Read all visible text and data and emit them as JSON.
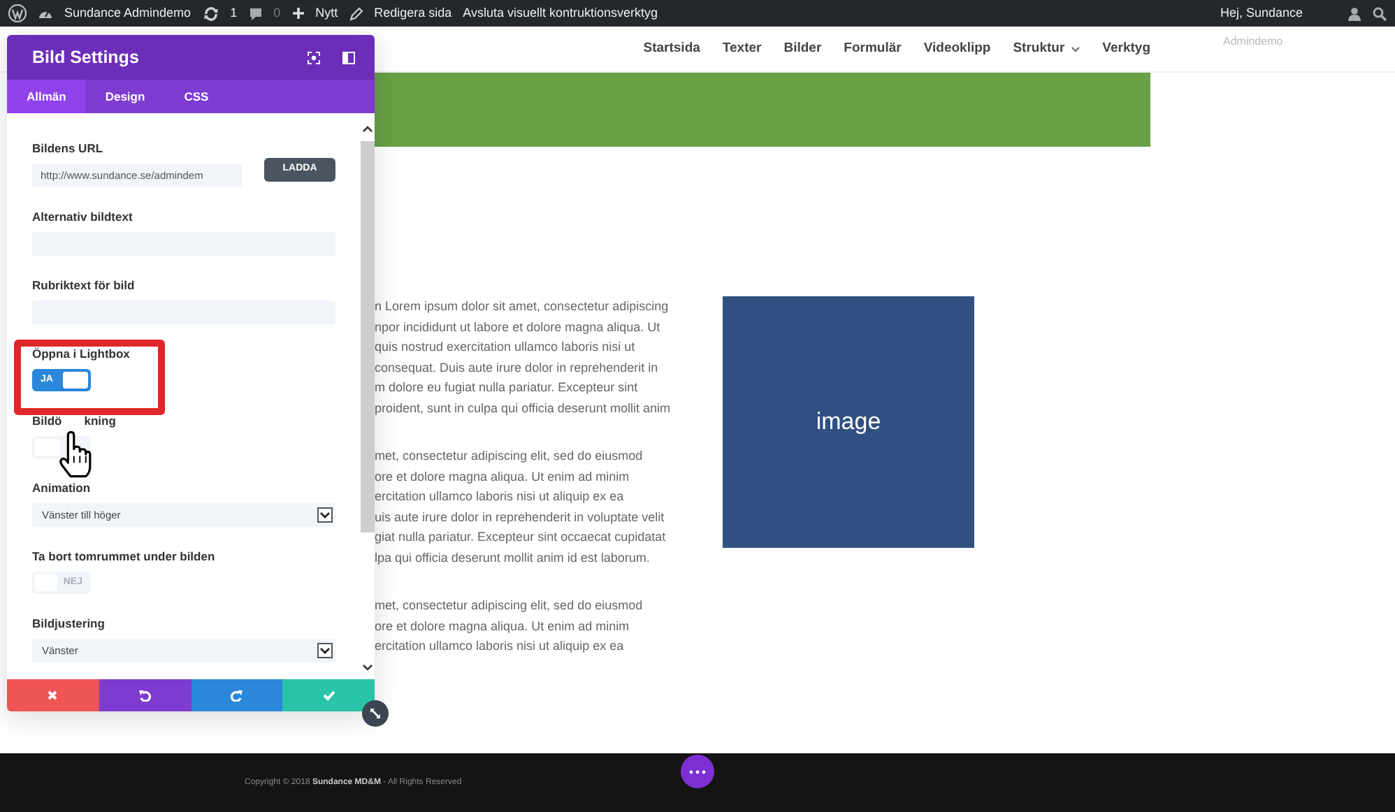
{
  "admin_bar": {
    "site_name": "Sundance Admindemo",
    "updates": "1",
    "comments": "0",
    "new_label": "Nytt",
    "edit_label": "Redigera sida",
    "exit_label": "Avsluta visuellt kontruktionsverktyg",
    "greeting": "Hej, Sundance",
    "account_hint": "Admindemo"
  },
  "nav": [
    {
      "label": "Startsida",
      "dropdown": false
    },
    {
      "label": "Texter",
      "dropdown": false
    },
    {
      "label": "Bilder",
      "dropdown": false
    },
    {
      "label": "Formulär",
      "dropdown": false
    },
    {
      "label": "Videoklipp",
      "dropdown": false
    },
    {
      "label": "Struktur",
      "dropdown": true
    },
    {
      "label": "Verktyg",
      "dropdown": false
    }
  ],
  "paragraphs": [
    [
      "n Lorem ipsum dolor sit amet, consectetur adipiscing",
      "npor incididunt ut labore et dolore magna aliqua. Ut",
      "quis nostrud exercitation ullamco laboris nisi ut",
      "consequat. Duis aute irure dolor in reprehenderit in",
      "m dolore eu fugiat nulla pariatur. Excepteur sint",
      "proident, sunt in culpa qui officia deserunt mollit anim"
    ],
    [
      "met, consectetur adipiscing elit, sed do eiusmod",
      "ore et dolore magna aliqua. Ut enim ad minim",
      "ercitation ullamco laboris nisi ut aliquip ex ea",
      "uis aute irure dolor in reprehenderit in voluptate velit",
      "giat nulla pariatur. Excepteur sint occaecat cupidatat",
      "lpa qui officia deserunt mollit anim id est laborum."
    ],
    [
      "met, consectetur adipiscing elit, sed do eiusmod",
      "ore et dolore magna aliqua. Ut enim ad minim",
      "ercitation ullamco laboris nisi ut aliquip ex ea"
    ]
  ],
  "image_placeholder": {
    "label": "image"
  },
  "footer": {
    "copyright": "Copyright © 2018 **Sundance MD&M** - All Rights Reserved"
  },
  "panel": {
    "title": "Bild Settings",
    "tabs": [
      {
        "label": "Allmän",
        "selected": true
      },
      {
        "label": "Design",
        "selected": false
      },
      {
        "label": "CSS",
        "selected": false
      }
    ],
    "fields": [
      {
        "kind": "url",
        "label": "Bildens URL",
        "value": "http://www.sundance.se/admindem",
        "button": "LADDA"
      },
      {
        "kind": "text",
        "label": "Alternativ bildtext"
      },
      {
        "kind": "text",
        "label": "Rubriktext för bild"
      },
      {
        "kind": "toggle",
        "label": "Öppna i Lightbox",
        "on": true,
        "state_text": "JA"
      },
      {
        "kind": "toggle",
        "label_parts": [
          "Bildö",
          "kning"
        ],
        "on": false
      },
      {
        "kind": "select",
        "label": "Animation",
        "value": "Vänster till höger"
      },
      {
        "kind": "toggle",
        "label": "Ta bort tomrummet under bilden",
        "on": false,
        "state_text": "NEJ"
      },
      {
        "kind": "select",
        "label": "Bildjustering",
        "value": "Vänster"
      }
    ],
    "actions": [
      {
        "kind": "cancel"
      },
      {
        "kind": "undo"
      },
      {
        "kind": "redo"
      },
      {
        "kind": "save"
      }
    ]
  }
}
